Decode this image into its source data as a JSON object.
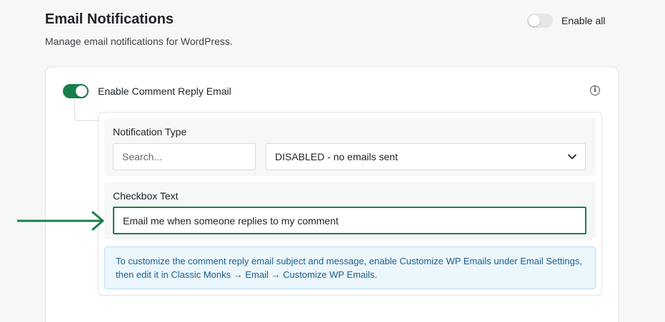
{
  "header": {
    "title": "Email Notifications",
    "subtitle": "Manage email notifications for WordPress.",
    "enable_all_label": "Enable all",
    "enable_all_on": false
  },
  "card": {
    "toggle_label": "Enable Comment Reply Email",
    "toggle_on": true,
    "info_icon": "info-icon",
    "notification_type": {
      "label": "Notification Type",
      "search_placeholder": "Search...",
      "selected": "DISABLED - no emails sent"
    },
    "checkbox_text": {
      "label": "Checkbox Text",
      "value": "Email me when someone replies to my comment"
    },
    "notice": "To customize the comment reply email subject and message, enable Customize WP Emails under Email Settings, then edit it in Classic Monks → Email → Customize WP Emails."
  },
  "colors": {
    "accent": "#1a7f4a",
    "notice_bg": "#ebf6fd",
    "notice_text": "#1d5f8a",
    "annotation_arrow": "#1a7f4a"
  },
  "icons": [
    "info-icon",
    "chevron-down-icon",
    "right-arrow-icon"
  ]
}
